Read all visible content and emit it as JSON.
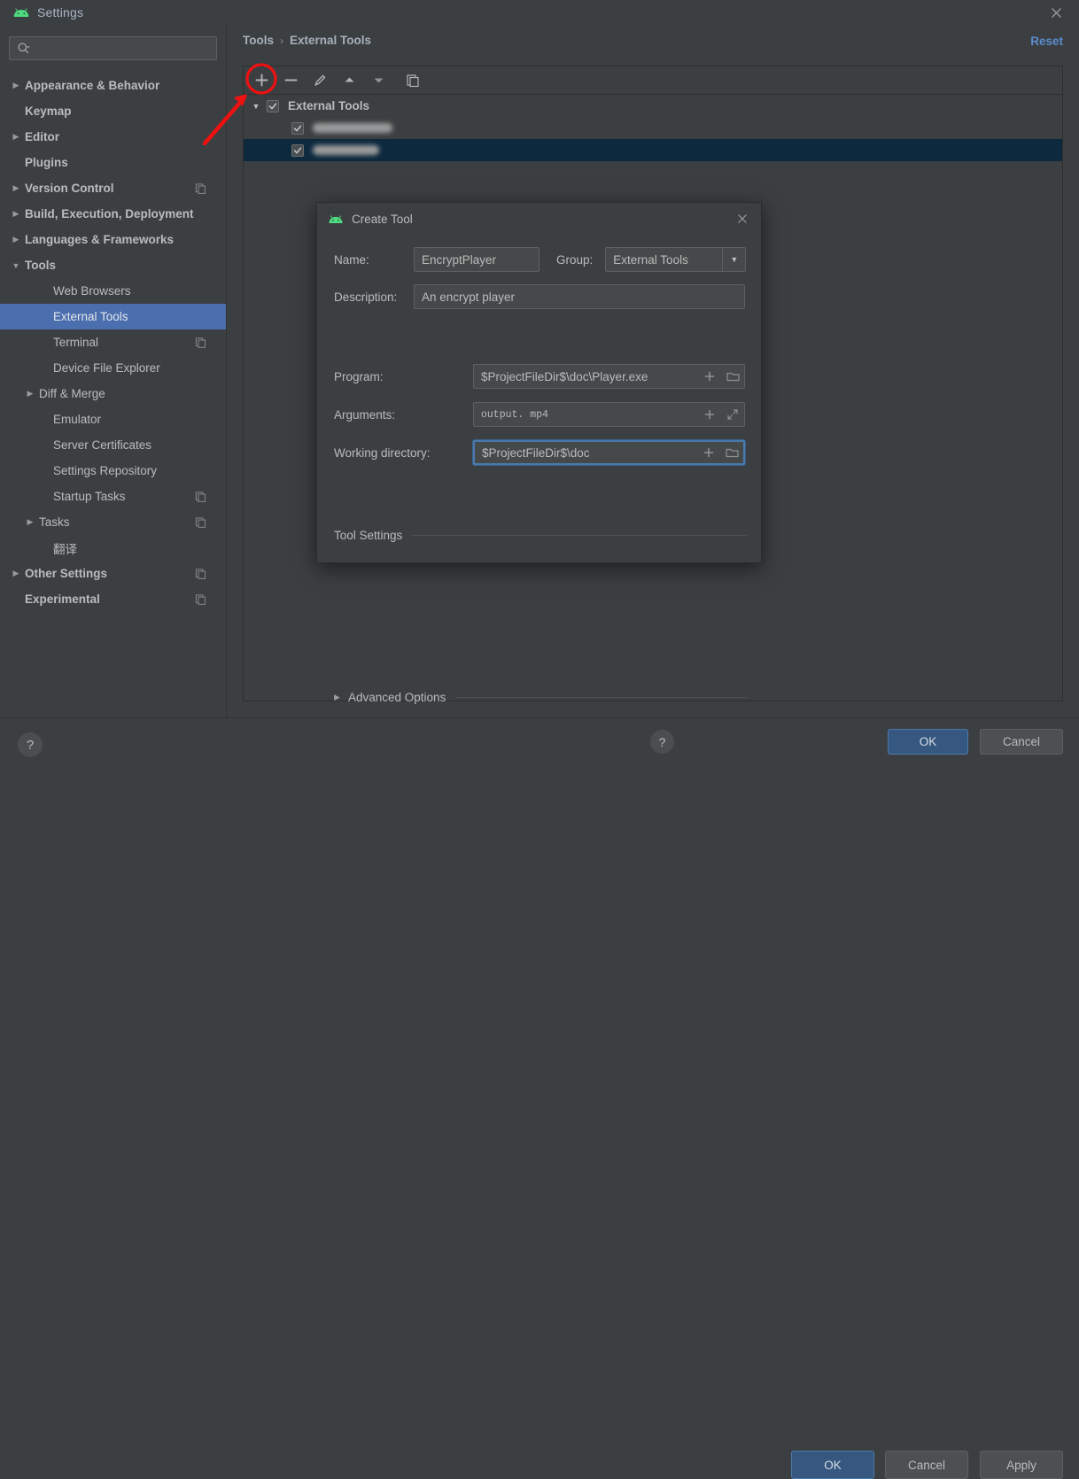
{
  "window": {
    "title": "Settings",
    "logo_icon": "android-logo-icon",
    "close_icon": "close-icon"
  },
  "search": {
    "placeholder": "",
    "value": "",
    "icon": "search-icon"
  },
  "sidebar": {
    "items": [
      {
        "label": "Appearance & Behavior",
        "level": 0,
        "arrow": "collapsed",
        "selected": false,
        "badge": false
      },
      {
        "label": "Keymap",
        "level": 0,
        "arrow": "none",
        "selected": false,
        "badge": false
      },
      {
        "label": "Editor",
        "level": 0,
        "arrow": "collapsed",
        "selected": false,
        "badge": false
      },
      {
        "label": "Plugins",
        "level": 0,
        "arrow": "none",
        "selected": false,
        "badge": false
      },
      {
        "label": "Version Control",
        "level": 0,
        "arrow": "collapsed",
        "selected": false,
        "badge": true
      },
      {
        "label": "Build, Execution, Deployment",
        "level": 0,
        "arrow": "collapsed",
        "selected": false,
        "badge": false
      },
      {
        "label": "Languages & Frameworks",
        "level": 0,
        "arrow": "collapsed",
        "selected": false,
        "badge": false
      },
      {
        "label": "Tools",
        "level": 0,
        "arrow": "expanded",
        "selected": false,
        "badge": false
      },
      {
        "label": "Web Browsers",
        "level": 1,
        "arrow": "none",
        "selected": false,
        "badge": false
      },
      {
        "label": "External Tools",
        "level": 1,
        "arrow": "none",
        "selected": true,
        "badge": false
      },
      {
        "label": "Terminal",
        "level": 1,
        "arrow": "none",
        "selected": false,
        "badge": true
      },
      {
        "label": "Device File Explorer",
        "level": 1,
        "arrow": "none",
        "selected": false,
        "badge": false
      },
      {
        "label": "Diff & Merge",
        "level": 1,
        "arrow": "collapsed",
        "selected": false,
        "badge": false
      },
      {
        "label": "Emulator",
        "level": 1,
        "arrow": "none",
        "selected": false,
        "badge": false
      },
      {
        "label": "Server Certificates",
        "level": 1,
        "arrow": "none",
        "selected": false,
        "badge": false
      },
      {
        "label": "Settings Repository",
        "level": 1,
        "arrow": "none",
        "selected": false,
        "badge": false
      },
      {
        "label": "Startup Tasks",
        "level": 1,
        "arrow": "none",
        "selected": false,
        "badge": true
      },
      {
        "label": "Tasks",
        "level": 1,
        "arrow": "collapsed",
        "selected": false,
        "badge": true
      },
      {
        "label": "翻译",
        "level": 1,
        "arrow": "none",
        "selected": false,
        "badge": false
      },
      {
        "label": "Other Settings",
        "level": 0,
        "arrow": "collapsed",
        "selected": false,
        "badge": true
      },
      {
        "label": "Experimental",
        "level": 0,
        "arrow": "none",
        "selected": false,
        "badge": true
      }
    ]
  },
  "main": {
    "breadcrumb": {
      "parent": "Tools",
      "separator": "›",
      "current": "External Tools"
    },
    "reset_label": "Reset",
    "toolbar": [
      {
        "name": "add-tool-button",
        "icon": "plus-icon",
        "highlighted": true
      },
      {
        "name": "remove-tool-button",
        "icon": "minus-icon",
        "highlighted": false
      },
      {
        "name": "edit-tool-button",
        "icon": "pencil-icon",
        "highlighted": false
      },
      {
        "name": "move-up-button",
        "icon": "arrow-up-icon",
        "highlighted": false
      },
      {
        "name": "move-down-button",
        "icon": "arrow-down-icon",
        "highlighted": false
      },
      {
        "name": "copy-tool-button",
        "icon": "copy-icon",
        "highlighted": false
      }
    ],
    "tree": {
      "root": {
        "label": "External Tools",
        "checked": true,
        "expanded": true
      },
      "children": [
        {
          "label": "",
          "redacted": true,
          "redacted_width": 90,
          "checked": true,
          "selected": false
        },
        {
          "label": "",
          "redacted": true,
          "redacted_width": 75,
          "checked": true,
          "selected": true
        }
      ]
    }
  },
  "footer": {
    "help_icon": "question-mark-icon",
    "ok_label": "OK",
    "cancel_label": "Cancel",
    "apply_label": "Apply"
  },
  "dialog": {
    "title": "Create Tool",
    "logo_icon": "android-logo-icon",
    "close_icon": "close-icon",
    "name_label": "Name:",
    "name_value": "EncryptPlayer",
    "group_label": "Group:",
    "group_value": "External Tools",
    "description_label": "Description:",
    "description_value": "An encrypt player",
    "tool_settings_legend": "Tool Settings",
    "program_label": "Program:",
    "program_value": "$ProjectFileDir$\\doc\\Player.exe",
    "arguments_label": "Arguments:",
    "arguments_value": "output. mp4",
    "working_dir_label": "Working directory:",
    "working_dir_value": "$ProjectFileDir$\\doc",
    "insert_macro_icon": "plus-icon",
    "browse_icon": "folder-icon",
    "expand_icon": "expand-diagonal-icon",
    "advanced_options_label": "Advanced Options",
    "help_icon": "question-mark-icon",
    "ok_label": "OK",
    "cancel_label": "Cancel"
  },
  "annotation": {
    "circle_color": "#ee1111",
    "arrow_color": "#ee1111"
  },
  "colors": {
    "accent_blue": "#4b6eaf",
    "link_blue": "#5b8bd0",
    "primary_button": "#365880",
    "tree_selection": "#0d293e",
    "background": "#3c3f41"
  }
}
